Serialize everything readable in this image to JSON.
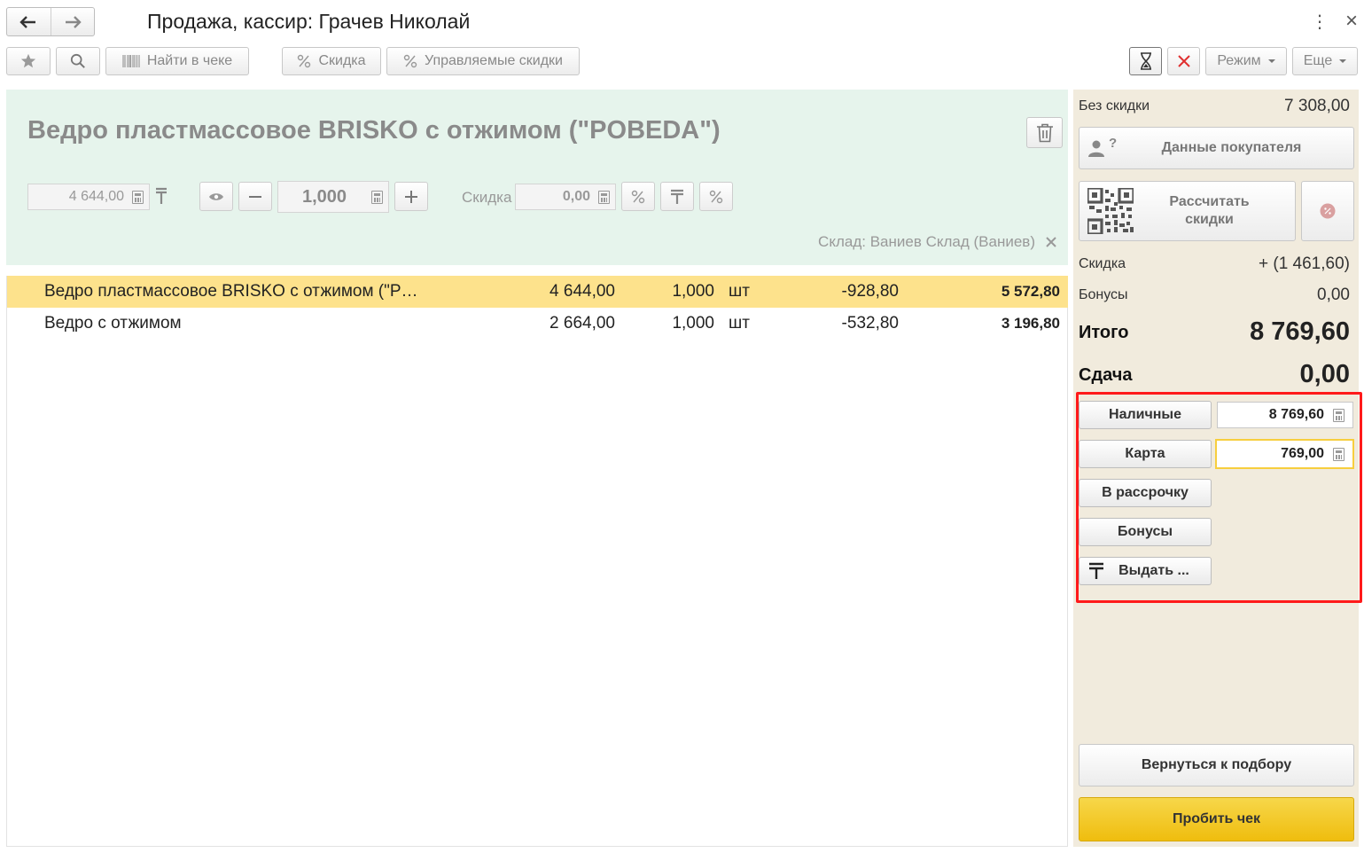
{
  "window": {
    "title": "Продажа, кассир: Грачев Николай",
    "more_glyph": "⋮",
    "close_glyph": "×"
  },
  "toolbar": {
    "find_in_receipt": "Найти в чеке",
    "discount": "Скидка",
    "managed_discounts": "Управляемые скидки",
    "mode": "Режим",
    "more": "Еще"
  },
  "product": {
    "name": "Ведро пластмассовое BRISKO с отжимом (\"POBEDA\")",
    "price": "4 644,00",
    "quantity": "1,000",
    "discount_label": "Скидка",
    "discount_value": "0,00",
    "warehouse": "Склад: Ваниев Склад (Ваниев)"
  },
  "items": [
    {
      "name": "Ведро пластмассовое BRISKO с отжимом (\"P…",
      "price": "4 644,00",
      "qty": "1,000",
      "unit": "шт",
      "discount": "-928,80",
      "sum": "5 572,80",
      "selected": true
    },
    {
      "name": "Ведро с отжимом",
      "price": "2 664,00",
      "qty": "1,000",
      "unit": "шт",
      "discount": "-532,80",
      "sum": "3 196,80",
      "selected": false
    }
  ],
  "summary": {
    "no_discount_label": "Без скидки",
    "no_discount_value": "7 308,00",
    "customer_button": "Данные покупателя",
    "customer_icon_mark": "?",
    "calc_discount_line1": "Рассчитать",
    "calc_discount_line2": "скидки",
    "discount_label": "Скидка",
    "discount_value": "+ (1 461,60)",
    "bonus_label": "Бонусы",
    "bonus_value": "0,00",
    "total_label": "Итого",
    "total_value": "8 769,60",
    "change_label": "Сдача",
    "change_value": "0,00"
  },
  "payments": {
    "cash_label": "Наличные",
    "cash_value": "8 769,60",
    "card_label": "Карта",
    "card_value": "769,00",
    "installment_label": "В рассрочку",
    "bonuses_label": "Бонусы",
    "issue_label": "Выдать ..."
  },
  "actions": {
    "back_to_selection": "Вернуться к подбору",
    "print_receipt": "Пробить чек"
  },
  "colors": {
    "selected_row": "#fde28c",
    "product_panel": "#e6f4ec",
    "side_panel": "#f1ebdd",
    "primary_button": "#f3c51c",
    "highlight": "#ff1a1a"
  }
}
